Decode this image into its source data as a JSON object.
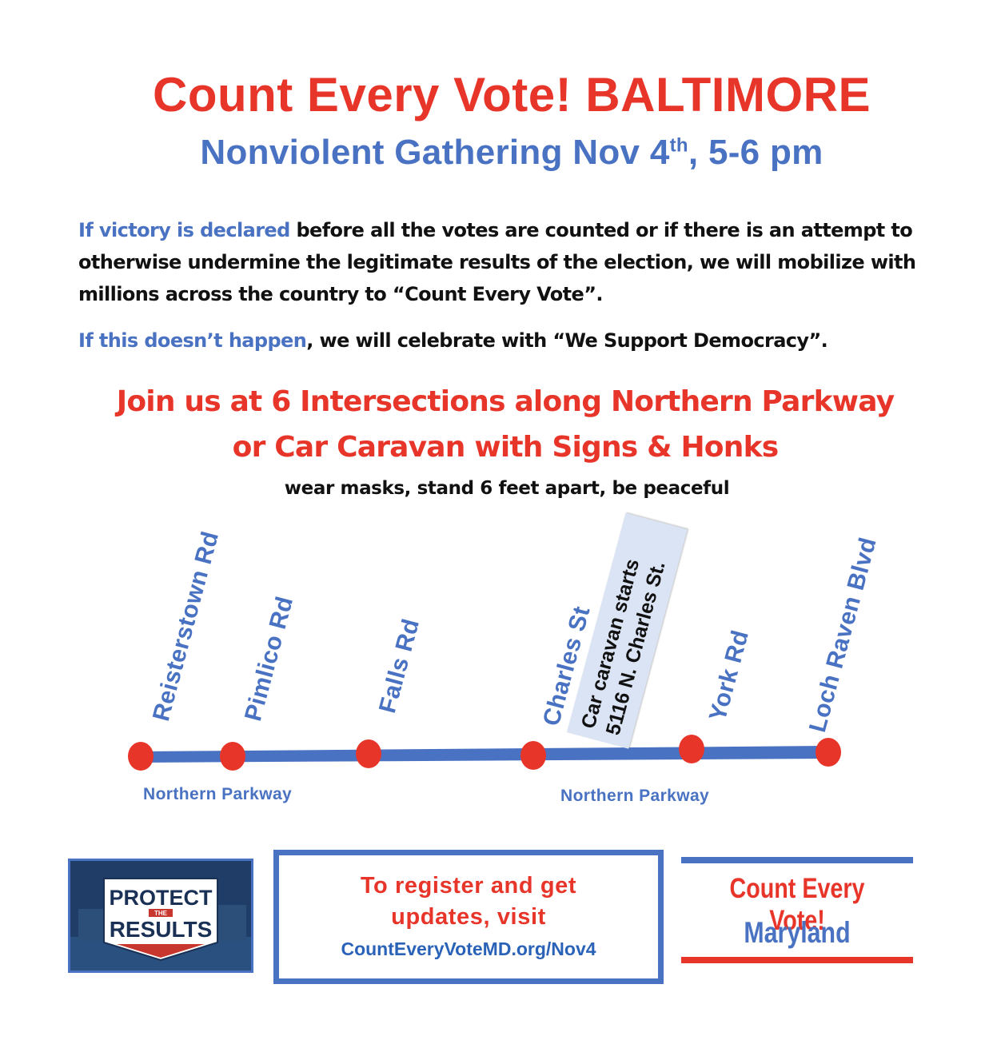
{
  "header": {
    "title": "Count Every Vote! BALTIMORE",
    "subtitle_main": "Nonviolent Gathering Nov 4",
    "subtitle_sup": "th",
    "subtitle_rest": ", 5-6 pm"
  },
  "body": {
    "p1_lead": "If victory is declared",
    "p1_line1_rest": " before all the votes are counted or if there is an attempt to",
    "p1_line2": "otherwise undermine the legitimate results of the election, we will mobilize with",
    "p1_line3": "millions across the country to “Count Every Vote”.",
    "p2_lead": "If this doesn’t happen",
    "p2_rest": ", we will celebrate with “We Support Democracy”."
  },
  "call_to_action": {
    "line1": "Join us at 6 Intersections along Northern Parkway",
    "line2": "or Car Caravan with Signs & Honks",
    "note": "wear masks, stand 6 feet apart, be peaceful"
  },
  "map": {
    "streets": [
      "Reisterstown Rd",
      "Pimlico Rd",
      "Falls Rd",
      "Charles St",
      "York Rd",
      "Loch Raven Blvd"
    ],
    "caravan_line1": "Car caravan starts",
    "caravan_line2": "5116 N. Charles St.",
    "parkway_label_left": "Northern Parkway",
    "parkway_label_right": "Northern Parkway",
    "line_color": "#4a72c2",
    "dot_color": "#e8352a"
  },
  "footer": {
    "logo_word1": "PROTECT",
    "logo_word2": "THE",
    "logo_word3": "RESULTS",
    "register_line1": "To register and get",
    "register_line2": "updates, visit",
    "register_url": "CountEveryVoteMD.org/Nov4",
    "badge_line1": "Count Every Vote!",
    "badge_line2": "Maryland"
  }
}
